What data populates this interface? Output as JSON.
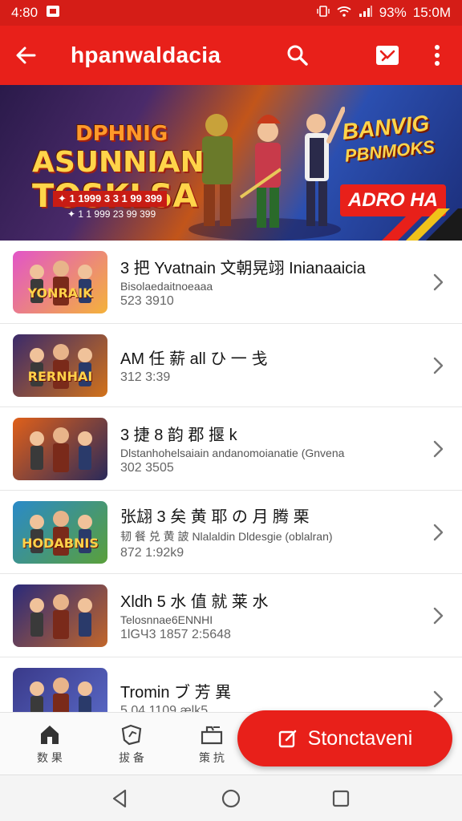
{
  "status_bar": {
    "time": "4:80",
    "battery": "93%",
    "clock": "15:0M"
  },
  "app_bar": {
    "title": "hpanwaldacia"
  },
  "banner": {
    "small_title": "DPHNIG",
    "title_line1": "ASUNNIAN",
    "title_line2": "TOSKLSA",
    "subline": "✦ 1 1999 3 3 1 99 399",
    "subline2": "✦ 1 1 999 23  99 399",
    "right_title_line1": "BANVIG",
    "right_title_line2": "PBNMOKS",
    "badge": "ADRO HA"
  },
  "list": {
    "items": [
      {
        "title": "3 把 Yvatnain 文朝晃翊 Inianaaicia",
        "subtitle": "Bisolaedaitnoeaaa",
        "meta": "523  3910",
        "thumb_label": "YONRAIK",
        "colors": [
          "#e255c8",
          "#f4b23a"
        ]
      },
      {
        "title": "AМ 任 薪 all ひ 一 戋",
        "subtitle": "",
        "meta": "312  3:39",
        "thumb_label": "RERNHAI",
        "colors": [
          "#3a2a6a",
          "#d2721a"
        ]
      },
      {
        "title": "3 捷 8 韵 郡 揠 k",
        "subtitle": "Dlstanhohelsaiain andanomoianatie (Gnvena",
        "meta": "302  3505",
        "thumb_label": "",
        "colors": [
          "#e0601a",
          "#2a2a5a"
        ]
      },
      {
        "title": "张翃 3 矣 黄 耶 の 月 腾 栗",
        "subtitle": "韧 餐 兑 黄 詖  Nlalaldin  Dldesgie (oblalran)",
        "meta": "872  1:92k9",
        "thumb_label": "HODABNIS",
        "colors": [
          "#2a8ac8",
          "#5aa03a"
        ]
      },
      {
        "title": "Xldh 5 水 值 就 莱 水",
        "subtitle": "Telosnnae6ENNHI",
        "meta": "1lGЧ3  1857  2:5648",
        "thumb_label": "",
        "colors": [
          "#2a2a7a",
          "#c2662a"
        ]
      },
      {
        "title": "Tromin ブ 芳 異",
        "subtitle": "",
        "meta": "5 04  1109 ælk5",
        "thumb_label": "",
        "colors": [
          "#3a3a8a",
          "#5a6ac8"
        ]
      }
    ]
  },
  "bottom_nav": {
    "items": [
      {
        "label": "数 果",
        "icon": "home-icon"
      },
      {
        "label": "拔 备",
        "icon": "tag-icon"
      },
      {
        "label": "策 抗",
        "icon": "cart-icon"
      }
    ]
  },
  "fab": {
    "label": "Stonctaveni",
    "icon": "edit-icon"
  },
  "colors": {
    "accent": "#e8201a",
    "status_bar": "#d51d17"
  }
}
